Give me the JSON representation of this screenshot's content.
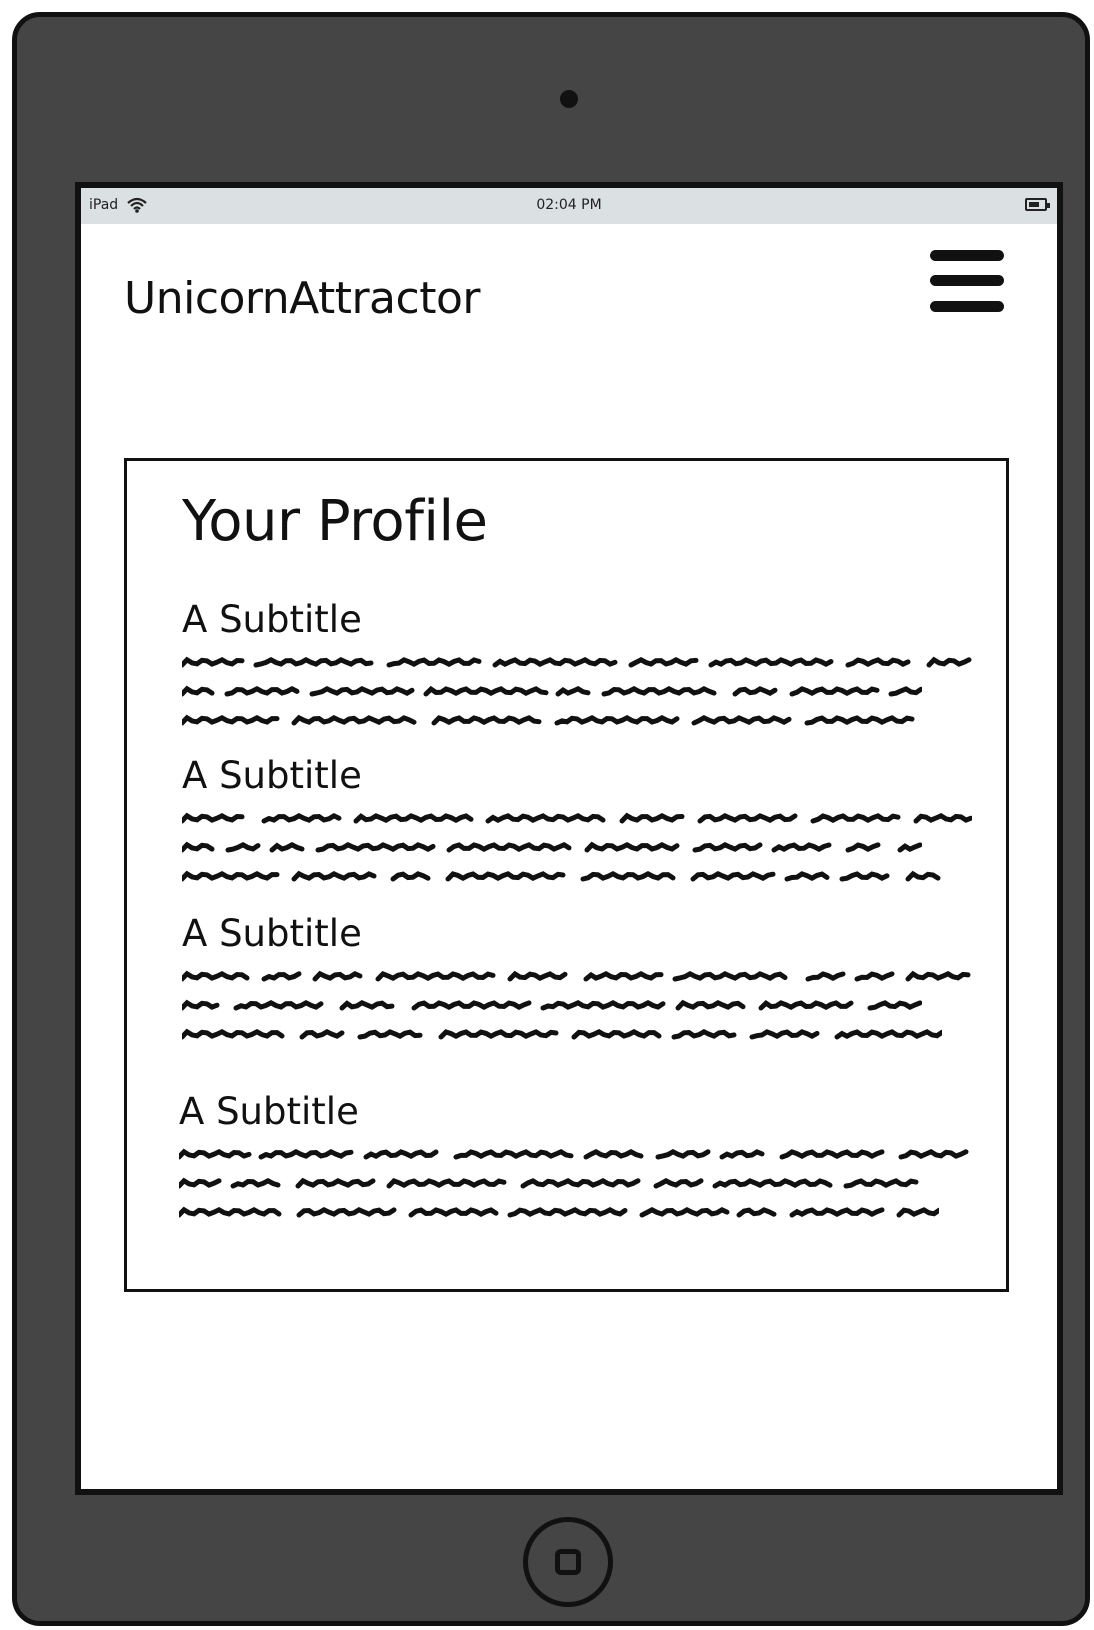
{
  "status_bar": {
    "device": "iPad",
    "time": "02:04 PM"
  },
  "app": {
    "title": "UnicornAttractor"
  },
  "profile": {
    "title": "Your Profile",
    "sections": [
      {
        "subtitle": "A Subtitle"
      },
      {
        "subtitle": "A Subtitle"
      },
      {
        "subtitle": "A Subtitle"
      },
      {
        "subtitle": "A Subtitle"
      }
    ]
  },
  "icons": {
    "wifi": "wifi-icon",
    "battery": "battery-icon",
    "menu": "hamburger-menu-icon",
    "home": "home-button-icon"
  }
}
